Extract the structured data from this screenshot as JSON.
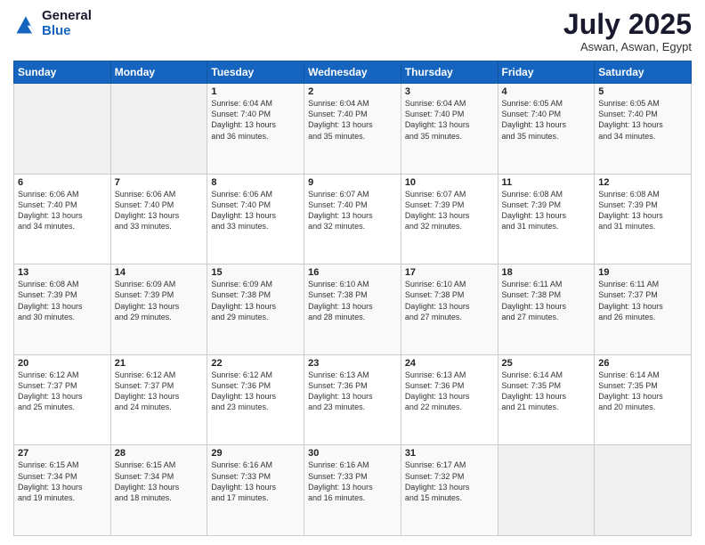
{
  "header": {
    "logo_line1": "General",
    "logo_line2": "Blue",
    "month": "July 2025",
    "location": "Aswan, Aswan, Egypt"
  },
  "weekdays": [
    "Sunday",
    "Monday",
    "Tuesday",
    "Wednesday",
    "Thursday",
    "Friday",
    "Saturday"
  ],
  "weeks": [
    [
      {
        "day": "",
        "info": ""
      },
      {
        "day": "",
        "info": ""
      },
      {
        "day": "1",
        "info": "Sunrise: 6:04 AM\nSunset: 7:40 PM\nDaylight: 13 hours\nand 36 minutes."
      },
      {
        "day": "2",
        "info": "Sunrise: 6:04 AM\nSunset: 7:40 PM\nDaylight: 13 hours\nand 35 minutes."
      },
      {
        "day": "3",
        "info": "Sunrise: 6:04 AM\nSunset: 7:40 PM\nDaylight: 13 hours\nand 35 minutes."
      },
      {
        "day": "4",
        "info": "Sunrise: 6:05 AM\nSunset: 7:40 PM\nDaylight: 13 hours\nand 35 minutes."
      },
      {
        "day": "5",
        "info": "Sunrise: 6:05 AM\nSunset: 7:40 PM\nDaylight: 13 hours\nand 34 minutes."
      }
    ],
    [
      {
        "day": "6",
        "info": "Sunrise: 6:06 AM\nSunset: 7:40 PM\nDaylight: 13 hours\nand 34 minutes."
      },
      {
        "day": "7",
        "info": "Sunrise: 6:06 AM\nSunset: 7:40 PM\nDaylight: 13 hours\nand 33 minutes."
      },
      {
        "day": "8",
        "info": "Sunrise: 6:06 AM\nSunset: 7:40 PM\nDaylight: 13 hours\nand 33 minutes."
      },
      {
        "day": "9",
        "info": "Sunrise: 6:07 AM\nSunset: 7:40 PM\nDaylight: 13 hours\nand 32 minutes."
      },
      {
        "day": "10",
        "info": "Sunrise: 6:07 AM\nSunset: 7:39 PM\nDaylight: 13 hours\nand 32 minutes."
      },
      {
        "day": "11",
        "info": "Sunrise: 6:08 AM\nSunset: 7:39 PM\nDaylight: 13 hours\nand 31 minutes."
      },
      {
        "day": "12",
        "info": "Sunrise: 6:08 AM\nSunset: 7:39 PM\nDaylight: 13 hours\nand 31 minutes."
      }
    ],
    [
      {
        "day": "13",
        "info": "Sunrise: 6:08 AM\nSunset: 7:39 PM\nDaylight: 13 hours\nand 30 minutes."
      },
      {
        "day": "14",
        "info": "Sunrise: 6:09 AM\nSunset: 7:39 PM\nDaylight: 13 hours\nand 29 minutes."
      },
      {
        "day": "15",
        "info": "Sunrise: 6:09 AM\nSunset: 7:38 PM\nDaylight: 13 hours\nand 29 minutes."
      },
      {
        "day": "16",
        "info": "Sunrise: 6:10 AM\nSunset: 7:38 PM\nDaylight: 13 hours\nand 28 minutes."
      },
      {
        "day": "17",
        "info": "Sunrise: 6:10 AM\nSunset: 7:38 PM\nDaylight: 13 hours\nand 27 minutes."
      },
      {
        "day": "18",
        "info": "Sunrise: 6:11 AM\nSunset: 7:38 PM\nDaylight: 13 hours\nand 27 minutes."
      },
      {
        "day": "19",
        "info": "Sunrise: 6:11 AM\nSunset: 7:37 PM\nDaylight: 13 hours\nand 26 minutes."
      }
    ],
    [
      {
        "day": "20",
        "info": "Sunrise: 6:12 AM\nSunset: 7:37 PM\nDaylight: 13 hours\nand 25 minutes."
      },
      {
        "day": "21",
        "info": "Sunrise: 6:12 AM\nSunset: 7:37 PM\nDaylight: 13 hours\nand 24 minutes."
      },
      {
        "day": "22",
        "info": "Sunrise: 6:12 AM\nSunset: 7:36 PM\nDaylight: 13 hours\nand 23 minutes."
      },
      {
        "day": "23",
        "info": "Sunrise: 6:13 AM\nSunset: 7:36 PM\nDaylight: 13 hours\nand 23 minutes."
      },
      {
        "day": "24",
        "info": "Sunrise: 6:13 AM\nSunset: 7:36 PM\nDaylight: 13 hours\nand 22 minutes."
      },
      {
        "day": "25",
        "info": "Sunrise: 6:14 AM\nSunset: 7:35 PM\nDaylight: 13 hours\nand 21 minutes."
      },
      {
        "day": "26",
        "info": "Sunrise: 6:14 AM\nSunset: 7:35 PM\nDaylight: 13 hours\nand 20 minutes."
      }
    ],
    [
      {
        "day": "27",
        "info": "Sunrise: 6:15 AM\nSunset: 7:34 PM\nDaylight: 13 hours\nand 19 minutes."
      },
      {
        "day": "28",
        "info": "Sunrise: 6:15 AM\nSunset: 7:34 PM\nDaylight: 13 hours\nand 18 minutes."
      },
      {
        "day": "29",
        "info": "Sunrise: 6:16 AM\nSunset: 7:33 PM\nDaylight: 13 hours\nand 17 minutes."
      },
      {
        "day": "30",
        "info": "Sunrise: 6:16 AM\nSunset: 7:33 PM\nDaylight: 13 hours\nand 16 minutes."
      },
      {
        "day": "31",
        "info": "Sunrise: 6:17 AM\nSunset: 7:32 PM\nDaylight: 13 hours\nand 15 minutes."
      },
      {
        "day": "",
        "info": ""
      },
      {
        "day": "",
        "info": ""
      }
    ]
  ]
}
